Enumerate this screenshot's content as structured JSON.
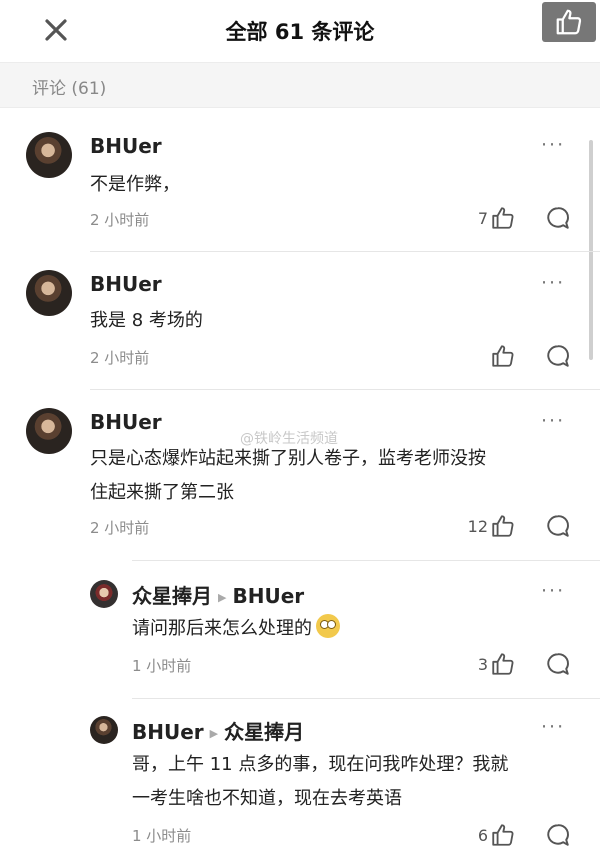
{
  "header": {
    "title": "全部 61 条评论"
  },
  "section": {
    "label": "评论 (61)"
  },
  "watermark": "@铁岭生活频道",
  "comments": [
    {
      "user": "BHUer",
      "text": "不是作弊，",
      "time": "2 小时前",
      "likes": "7"
    },
    {
      "user": "BHUer",
      "text": "我是 8 考场的",
      "time": "2 小时前",
      "likes": ""
    },
    {
      "user": "BHUer",
      "text_lines": [
        "只是心态爆炸站起来撕了别人卷子，监考老师没按",
        "住起来撕了第二张"
      ],
      "time": "2 小时前",
      "likes": "12"
    }
  ],
  "replies": [
    {
      "user": "众星捧月",
      "reply_to": "BHUer",
      "text": "请问那后来怎么处理的",
      "emoji": "flushed-face-emoji",
      "time": "1 小时前",
      "likes": "3"
    },
    {
      "user": "BHUer",
      "reply_to": "众星捧月",
      "text_lines": [
        "哥，上午 11 点多的事，现在问我咋处理？我就",
        "一考生啥也不知道，现在去考英语"
      ],
      "time": "1 小时前",
      "likes": "6"
    }
  ],
  "icons": {
    "close": "close-icon",
    "like": "thumbs-up-icon",
    "comment": "comment-bubble-icon",
    "more": "more-dots-icon"
  },
  "more_label": "···"
}
